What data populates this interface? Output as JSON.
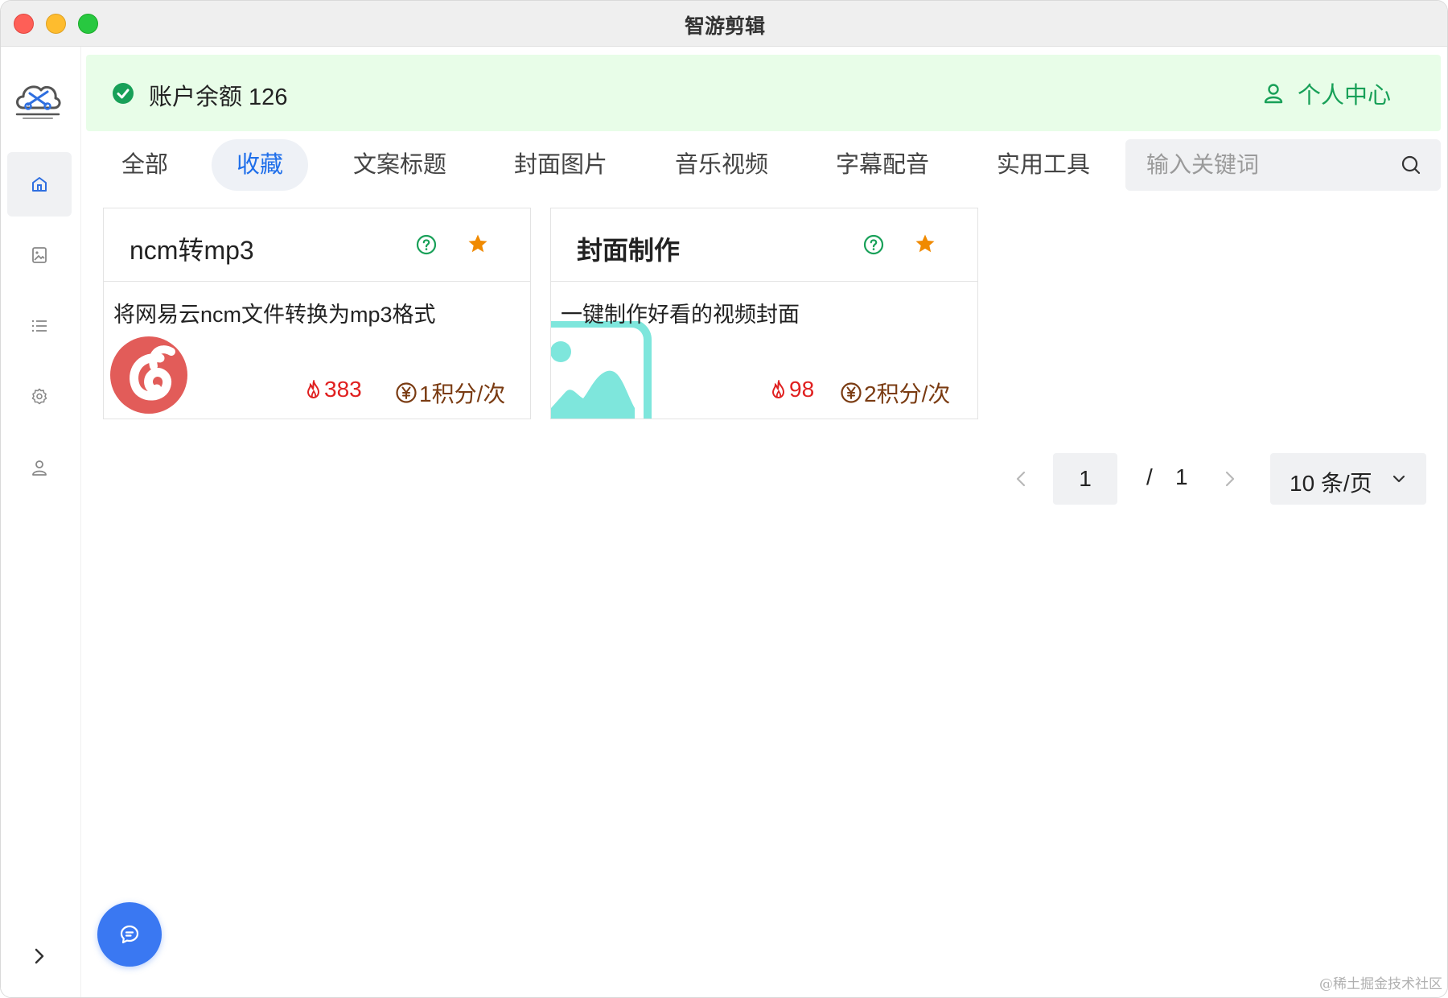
{
  "window": {
    "title": "智游剪辑"
  },
  "sidebar": {
    "items": [
      {
        "name": "home",
        "icon": "home-icon",
        "active": true
      },
      {
        "name": "image",
        "icon": "image-icon",
        "active": false
      },
      {
        "name": "list",
        "icon": "list-icon",
        "active": false
      },
      {
        "name": "settings",
        "icon": "gear-icon",
        "active": false
      },
      {
        "name": "user",
        "icon": "user-icon",
        "active": false
      }
    ]
  },
  "banner": {
    "balance_text": "账户余额 126",
    "user_center_label": "个人中心"
  },
  "tabs": [
    {
      "label": "全部",
      "active": false
    },
    {
      "label": "收藏",
      "active": true
    },
    {
      "label": "文案标题",
      "active": false
    },
    {
      "label": "封面图片",
      "active": false
    },
    {
      "label": "音乐视频",
      "active": false
    },
    {
      "label": "字幕配音",
      "active": false
    },
    {
      "label": "实用工具",
      "active": false
    }
  ],
  "search": {
    "placeholder": "输入关键词",
    "value": ""
  },
  "cards": [
    {
      "title": "ncm转mp3",
      "description": "将网易云ncm文件转换为mp3格式",
      "heat": "383",
      "cost": "1积分/次",
      "image": "netease-music-logo",
      "favorited": true
    },
    {
      "title": "封面制作",
      "description": "一键制作好看的视频封面",
      "heat": "98",
      "cost": "2积分/次",
      "image": "image-placeholder-icon",
      "favorited": true
    }
  ],
  "pagination": {
    "current_page": "1",
    "separator": "/",
    "total_pages": "1",
    "page_size_label": "10 条/页"
  },
  "watermark": "@稀土掘金技术社区",
  "colors": {
    "accent_blue": "#1f6fea",
    "success_green": "#18a058",
    "banner_bg": "#e8fde8",
    "heat_red": "#e02020",
    "star_orange": "#f08a00",
    "fab_blue": "#3a78f2"
  }
}
